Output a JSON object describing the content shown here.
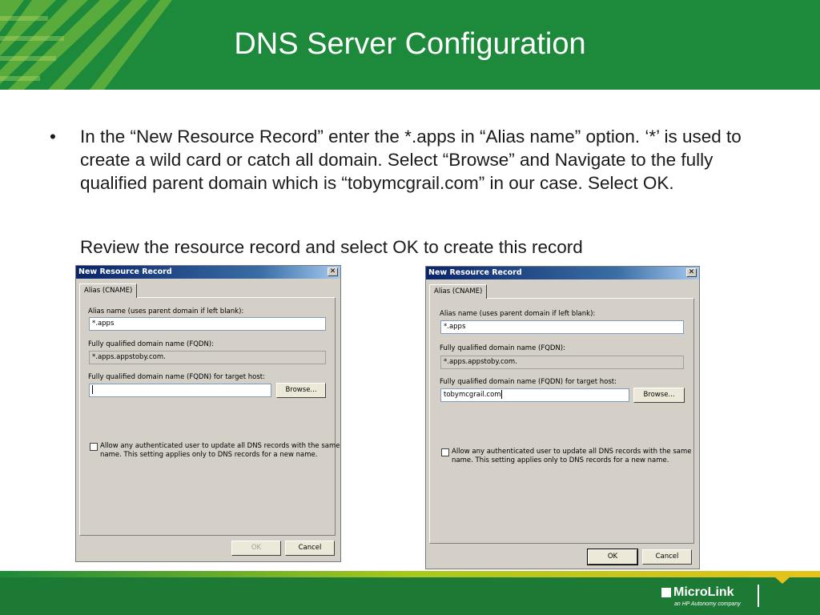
{
  "slide": {
    "title": "DNS Server Configuration",
    "bullet": "•",
    "paragraph": "In the “New Resource Record” enter the *.apps in “Alias name” option. ‘*’ is used to create a wild card or catch all domain. Select “Browse” and Navigate to the fully qualified parent domain which is “tobymcgrail.com” in our case. Select OK.",
    "review": "Review the resource record and select OK to create this record"
  },
  "dialog_left": {
    "title": "New Resource Record",
    "close_glyph": "✕",
    "tab": "Alias (CNAME)",
    "alias_label": "Alias name (uses parent domain if left blank):",
    "alias_value": "*.apps",
    "fqdn_label": "Fully qualified domain name (FQDN):",
    "fqdn_value": "*.apps.appstoby.com.",
    "target_label": "Fully qualified domain name (FQDN) for target host:",
    "target_value": "",
    "browse": "Browse...",
    "checkbox_label": "Allow any authenticated user to update all DNS records with the same name. This setting applies only to DNS records for a new name.",
    "ok": "OK",
    "cancel": "Cancel"
  },
  "dialog_right": {
    "title": "New Resource Record",
    "close_glyph": "✕",
    "tab": "Alias (CNAME)",
    "alias_label": "Alias name (uses parent domain if left blank):",
    "alias_value": "*.apps",
    "fqdn_label": "Fully qualified domain name (FQDN):",
    "fqdn_value": "*.apps.appstoby.com.",
    "target_label": "Fully qualified domain name (FQDN) for target host:",
    "target_value": "tobymcgrail.com",
    "browse": "Browse...",
    "checkbox_label": "Allow any authenticated user to update all DNS records with the same name. This setting applies only to DNS records for a new name.",
    "ok": "OK",
    "cancel": "Cancel"
  },
  "footer": {
    "logo_name": "MicroLink",
    "logo_tagline": "an HP Autonomy company"
  },
  "colors": {
    "header_green": "#1c8a3a",
    "footer_green": "#1c7a34",
    "accent_yellow": "#e8c21c"
  }
}
